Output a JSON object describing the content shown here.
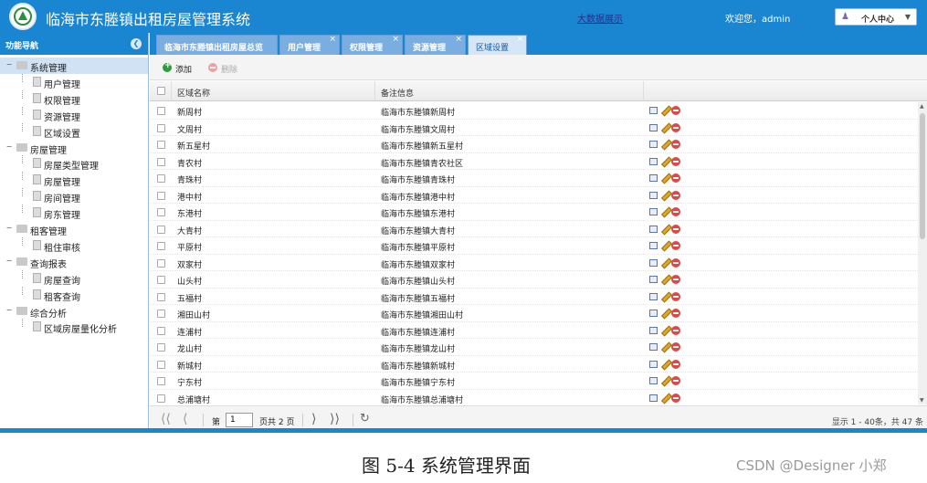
{
  "header": {
    "title": "临海市东塍镇出租房屋管理系统",
    "bigdata_link": "大数据展示",
    "welcome": "欢迎您，admin",
    "user_menu": "个人中心"
  },
  "sidebar": {
    "title": "功能导航",
    "tree": [
      {
        "label": "系统管理",
        "level": 0,
        "selected": true
      },
      {
        "label": "用户管理",
        "level": 1
      },
      {
        "label": "权限管理",
        "level": 1
      },
      {
        "label": "资源管理",
        "level": 1
      },
      {
        "label": "区域设置",
        "level": 1
      },
      {
        "label": "房屋管理",
        "level": 0
      },
      {
        "label": "房屋类型管理",
        "level": 1
      },
      {
        "label": "房屋管理",
        "level": 1
      },
      {
        "label": "房间管理",
        "level": 1
      },
      {
        "label": "房东管理",
        "level": 1
      },
      {
        "label": "租客管理",
        "level": 0
      },
      {
        "label": "租住审核",
        "level": 1
      },
      {
        "label": "查询报表",
        "level": 0
      },
      {
        "label": "房屋查询",
        "level": 1
      },
      {
        "label": "租客查询",
        "level": 1
      },
      {
        "label": "综合分析",
        "level": 0
      },
      {
        "label": "区域房屋量化分析",
        "level": 1
      }
    ]
  },
  "tabs": [
    {
      "label": "临海市东塍镇出租房屋总览",
      "closable": false,
      "active": false
    },
    {
      "label": "用户管理",
      "closable": true,
      "active": false
    },
    {
      "label": "权限管理",
      "closable": true,
      "active": false
    },
    {
      "label": "资源管理",
      "closable": true,
      "active": false
    },
    {
      "label": "区域设置",
      "closable": true,
      "active": true
    }
  ],
  "toolbar": {
    "add_label": "添加",
    "delete_label": "删除"
  },
  "grid": {
    "columns": [
      "区域名称",
      "备注信息"
    ],
    "rows": [
      {
        "name": "新周村",
        "note": "临海市东塍镇新周村"
      },
      {
        "name": "文周村",
        "note": "临海市东塍镇文周村"
      },
      {
        "name": "新五星村",
        "note": "临海市东塍镇新五星村"
      },
      {
        "name": "青农村",
        "note": "临海市东塍镇青农社区"
      },
      {
        "name": "青珠村",
        "note": "临海市东塍镇青珠村"
      },
      {
        "name": "港中村",
        "note": "临海市东塍镇港中村"
      },
      {
        "name": "东港村",
        "note": "临海市东塍镇东港村"
      },
      {
        "name": "大青村",
        "note": "临海市东塍镇大青村"
      },
      {
        "name": "平原村",
        "note": "临海市东塍镇平原村"
      },
      {
        "name": "双家村",
        "note": "临海市东塍镇双家村"
      },
      {
        "name": "山头村",
        "note": "临海市东塍镇山头村"
      },
      {
        "name": "五福村",
        "note": "临海市东塍镇五福村"
      },
      {
        "name": "湘田山村",
        "note": "临海市东塍镇湘田山村"
      },
      {
        "name": "连浦村",
        "note": "临海市东塍镇连浦村"
      },
      {
        "name": "龙山村",
        "note": "临海市东塍镇龙山村"
      },
      {
        "name": "新城村",
        "note": "临海市东塍镇新城村"
      },
      {
        "name": "宁东村",
        "note": "临海市东塍镇宁东村"
      },
      {
        "name": "总浦塘村",
        "note": "临海市东塍镇总浦塘村"
      }
    ]
  },
  "pager": {
    "page_label": "第",
    "current_page": "1",
    "total_label": "页共 2 页",
    "summary": "显示 1 - 40条，共 47 条"
  },
  "caption": "图 5-4 系统管理界面",
  "watermark": "CSDN @Designer 小郑",
  "colors": {
    "primary": "#1a86d2",
    "selected_row": "#d0e3f5",
    "active_tab": "#d6e6f6"
  },
  "icons": [
    "app-logo-icon",
    "user-icon",
    "chevron-down-icon",
    "collapse-icon",
    "folder-icon",
    "document-icon",
    "add-icon",
    "delete-icon",
    "view-icon",
    "edit-icon",
    "remove-icon",
    "first-page-icon",
    "prev-page-icon",
    "next-page-icon",
    "last-page-icon",
    "refresh-icon"
  ]
}
